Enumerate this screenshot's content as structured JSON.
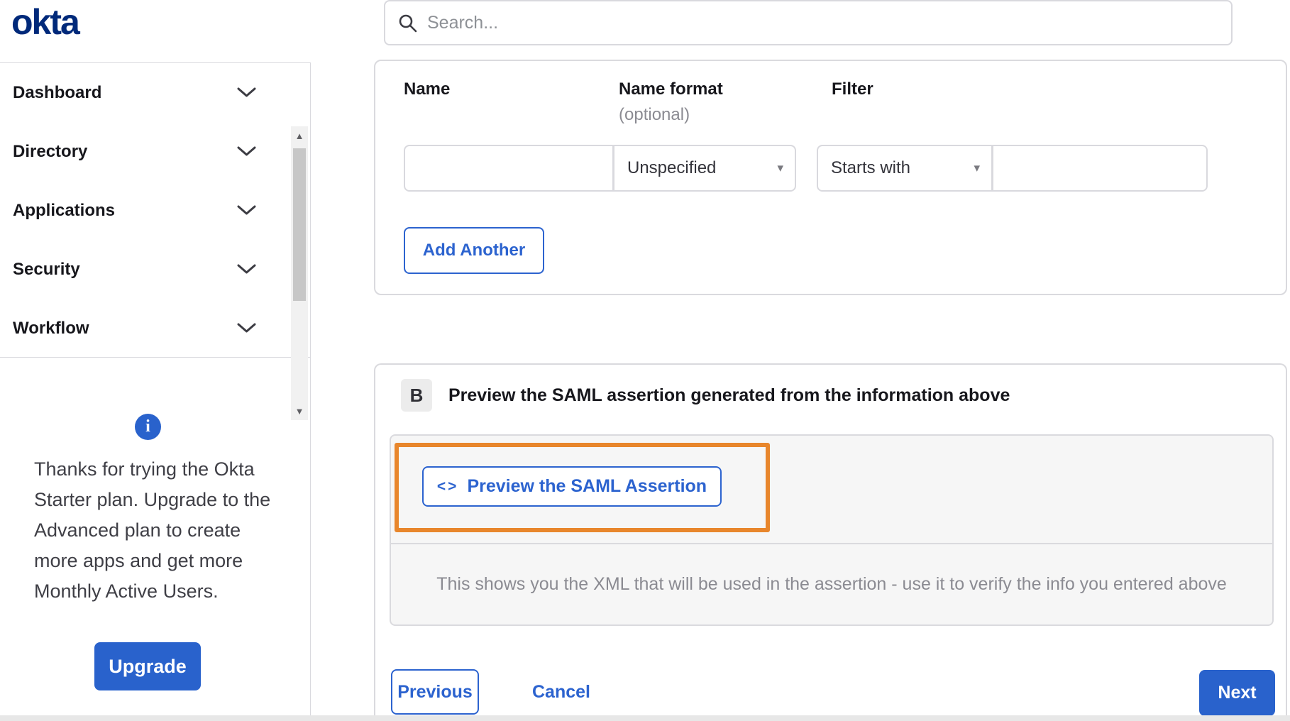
{
  "brand": {
    "logo_text": "okta",
    "logo_color": "#00297a"
  },
  "header": {
    "search_placeholder": "Search..."
  },
  "icons": {
    "select_caret": "▾",
    "scroll_up": "▲",
    "scroll_down": "▼",
    "info_glyph": "i",
    "code_glyph": "<>"
  },
  "sidebar": {
    "items": [
      {
        "label": "Dashboard"
      },
      {
        "label": "Directory"
      },
      {
        "label": "Applications"
      },
      {
        "label": "Security"
      },
      {
        "label": "Workflow"
      }
    ],
    "upsell": {
      "text": "Thanks for trying the Okta Starter plan. Upgrade to the Advanced plan to create more apps and get more Monthly Active Users.",
      "button_label": "Upgrade"
    }
  },
  "attribute_form": {
    "columns": {
      "name_label": "Name",
      "name_format_label": "Name format",
      "name_format_hint": "(optional)",
      "filter_label": "Filter"
    },
    "name_value": "",
    "name_format_selected": "Unspecified",
    "filter_type_selected": "Starts with",
    "filter_value": "",
    "add_another_label": "Add Another"
  },
  "preview_section": {
    "step_badge": "B",
    "heading": "Preview the SAML assertion generated from the information above",
    "preview_button_label": "Preview the SAML Assertion",
    "help_text": "This shows you the XML that will be used in the assertion - use it to verify the info you entered above"
  },
  "footer": {
    "previous_label": "Previous",
    "cancel_label": "Cancel",
    "next_label": "Next"
  },
  "colors": {
    "accent_blue": "#2962cc",
    "link_blue": "#2c63cf",
    "logo_navy": "#00297a",
    "highlight_orange": "#e8862c",
    "border_gray": "#d9d9de",
    "panel_gray": "#f6f6f6",
    "muted_text": "#8b8b92"
  }
}
